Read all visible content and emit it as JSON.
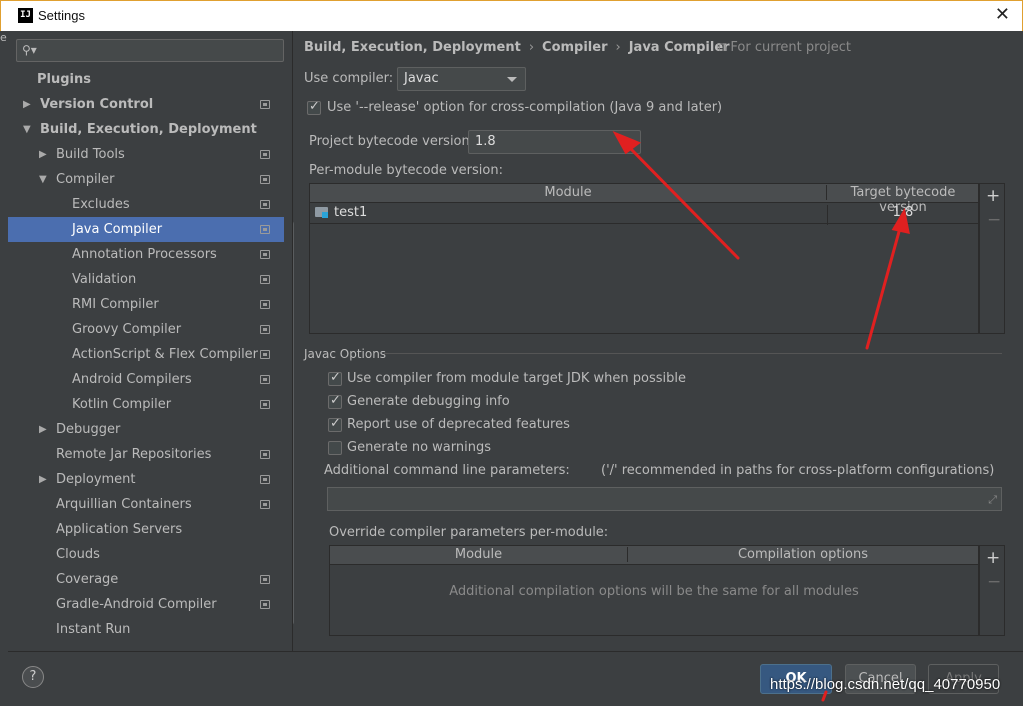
{
  "window": {
    "title": "Settings",
    "app_icon": "IJ",
    "close": "✕",
    "edge_char": "e"
  },
  "search": {
    "placeholder": ""
  },
  "sidebar": {
    "items": [
      {
        "label": "Plugins"
      },
      {
        "label": "Version Control"
      },
      {
        "label": "Build, Execution, Deployment"
      },
      {
        "label": "Build Tools"
      },
      {
        "label": "Compiler"
      },
      {
        "label": "Excludes"
      },
      {
        "label": "Java Compiler"
      },
      {
        "label": "Annotation Processors"
      },
      {
        "label": "Validation"
      },
      {
        "label": "RMI Compiler"
      },
      {
        "label": "Groovy Compiler"
      },
      {
        "label": "ActionScript & Flex Compiler"
      },
      {
        "label": "Android Compilers"
      },
      {
        "label": "Kotlin Compiler"
      },
      {
        "label": "Debugger"
      },
      {
        "label": "Remote Jar Repositories"
      },
      {
        "label": "Deployment"
      },
      {
        "label": "Arquillian Containers"
      },
      {
        "label": "Application Servers"
      },
      {
        "label": "Clouds"
      },
      {
        "label": "Coverage"
      },
      {
        "label": "Gradle-Android Compiler"
      },
      {
        "label": "Instant Run"
      }
    ]
  },
  "breadcrumb": {
    "parts": [
      "Build, Execution, Deployment",
      "Compiler",
      "Java Compiler"
    ],
    "sep": "›",
    "scope": "⧉ For current project"
  },
  "compiler": {
    "use_compiler_label": "Use compiler:",
    "use_compiler_value": "Javac",
    "release_option_label": "Use '--release' option for cross-compilation (Java 9 and later)",
    "release_option_checked": true,
    "project_bytecode_label": "Project bytecode version:",
    "project_bytecode_value": "1.8",
    "per_module_label": "Per-module bytecode version:",
    "module_table": {
      "headers": [
        "Module",
        "Target bytecode version"
      ],
      "rows": [
        {
          "module": "test1",
          "target": "1.8"
        }
      ]
    }
  },
  "javac": {
    "section_title": "Javac Options",
    "options": [
      {
        "label": "Use compiler from module target JDK when possible",
        "checked": true
      },
      {
        "label": "Generate debugging info",
        "checked": true
      },
      {
        "label": "Report use of deprecated features",
        "checked": true
      },
      {
        "label": "Generate no warnings",
        "checked": false
      }
    ],
    "additional_params_label": "Additional command line parameters:",
    "additional_params_hint": "('/' recommended in paths for cross-platform configurations)",
    "additional_params_value": "",
    "override_label": "Override compiler parameters per-module:",
    "override_table": {
      "headers": [
        "Module",
        "Compilation options"
      ],
      "empty_text": "Additional compilation options will be the same for all modules"
    }
  },
  "toolbar": {
    "plus": "+",
    "minus": "−"
  },
  "buttons": {
    "help": "?",
    "ok": "OK",
    "cancel": "Cancel",
    "apply": "Apply"
  },
  "watermark": "https://blog.csdn.net/qq_40770950",
  "colors": {
    "selection": "#4b6eaf",
    "annotation_arrow": "#e02020",
    "ok_button": "#365880"
  }
}
